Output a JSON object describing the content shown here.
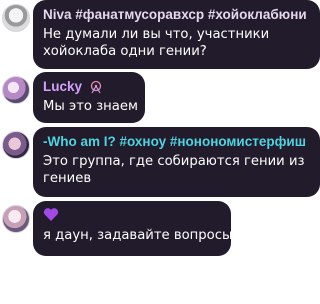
{
  "messages": [
    {
      "author": "Niva",
      "author_tags": "#фанатмусоравхср #хойоклабюни",
      "name_color": "#e7d7ef",
      "badge_icon": "ghost-icon",
      "lines": [
        "Не думали ли вы что, участники",
        "хойоклаба одни гении?"
      ]
    },
    {
      "author": "Lucky",
      "author_tags": "",
      "name_color": "#d4a1ff",
      "badge_icon": "ferris-wheel-icon",
      "lines": [
        "Мы это знаем"
      ]
    },
    {
      "author": "-Who am I? #охноу #нонономистерфиш",
      "author_tags": "",
      "name_color": "#4fd3e0",
      "lines": [
        "Это группа, где собираются гении из",
        "гениев"
      ]
    },
    {
      "author": "",
      "author_tags": "",
      "name_icon": "purple-heart-icon",
      "lines": [
        "я даун, задавайте вопросы?"
      ]
    }
  ],
  "colors": {
    "bubble": "#211b2b",
    "text": "#ffffff",
    "heart": "#a349e8"
  }
}
